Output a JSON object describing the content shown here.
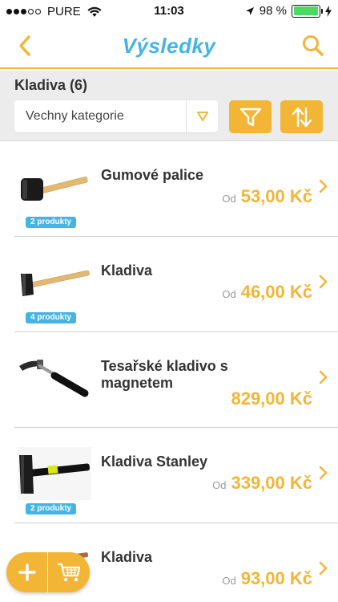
{
  "status_bar": {
    "carrier": "PURE",
    "time": "11:03",
    "battery": "98 %",
    "battery_level": 0.98,
    "signal_bars_filled": 3,
    "signal_bars_total": 5
  },
  "navbar": {
    "title": "Výsledky"
  },
  "filter": {
    "category_title": "Kladiva (6)",
    "category_select_value": "Vechny kategorie"
  },
  "products": [
    {
      "name": "Gumové palice",
      "price_prefix": "Od",
      "price": "53,00 Kč",
      "badge": "2 produkty",
      "image_icon": "rubber-mallet-icon"
    },
    {
      "name": "Kladiva",
      "price_prefix": "Od",
      "price": "46,00 Kč",
      "badge": "4 produkty",
      "image_icon": "hammer-wood-icon"
    },
    {
      "name": "Tesařské kladivo s magnetem",
      "price_prefix": "",
      "price": "829,00 Kč",
      "badge": "",
      "image_icon": "carpenter-hammer-icon"
    },
    {
      "name": "Kladiva Stanley",
      "price_prefix": "Od",
      "price": "339,00 Kč",
      "badge": "2 produkty",
      "image_icon": "stanley-hammer-icon"
    },
    {
      "name": "Kladiva",
      "price_prefix": "Od",
      "price": "93,00 Kč",
      "badge": "",
      "image_icon": "hammer-icon"
    }
  ],
  "colors": {
    "accent": "#f3b536",
    "title_blue": "#42b4e6",
    "badge_blue": "#42b4e6",
    "filter_bg": "#ececec"
  }
}
